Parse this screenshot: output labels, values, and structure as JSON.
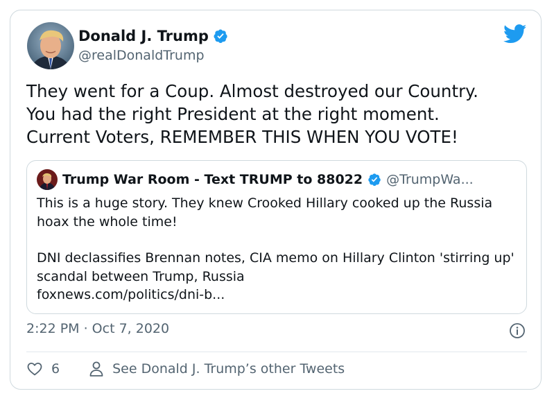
{
  "author": {
    "name": "Donald J. Trump",
    "handle": "@realDonaldTrump"
  },
  "tweet": {
    "text": "They went for a Coup. Almost destroyed our Country.\nYou had the right President at the right moment.\nCurrent Voters, REMEMBER THIS WHEN YOU VOTE!"
  },
  "quoted": {
    "name": "Trump War Room - Text TRUMP to 88022",
    "handle": "@TrumpWa...",
    "text_1": "This is a huge story. They knew Crooked Hillary cooked up the Russia hoax the whole time!",
    "text_2": "DNI declassifies Brennan notes, CIA memo on Hillary Clinton 'stirring up' scandal between Trump, Russia",
    "link": "foxnews.com/politics/dni-b..."
  },
  "meta": {
    "timestamp": "2:22 PM · Oct 7, 2020"
  },
  "actions": {
    "like_count": "6",
    "other_tweets_label": "See Donald J. Trump’s other Tweets"
  },
  "colors": {
    "twitter_blue": "#1d9bf0",
    "secondary_text": "#536471",
    "border": "#cfd9de"
  },
  "icons": [
    "verified-badge-icon",
    "twitter-bird-icon",
    "info-icon",
    "heart-icon",
    "person-icon"
  ]
}
